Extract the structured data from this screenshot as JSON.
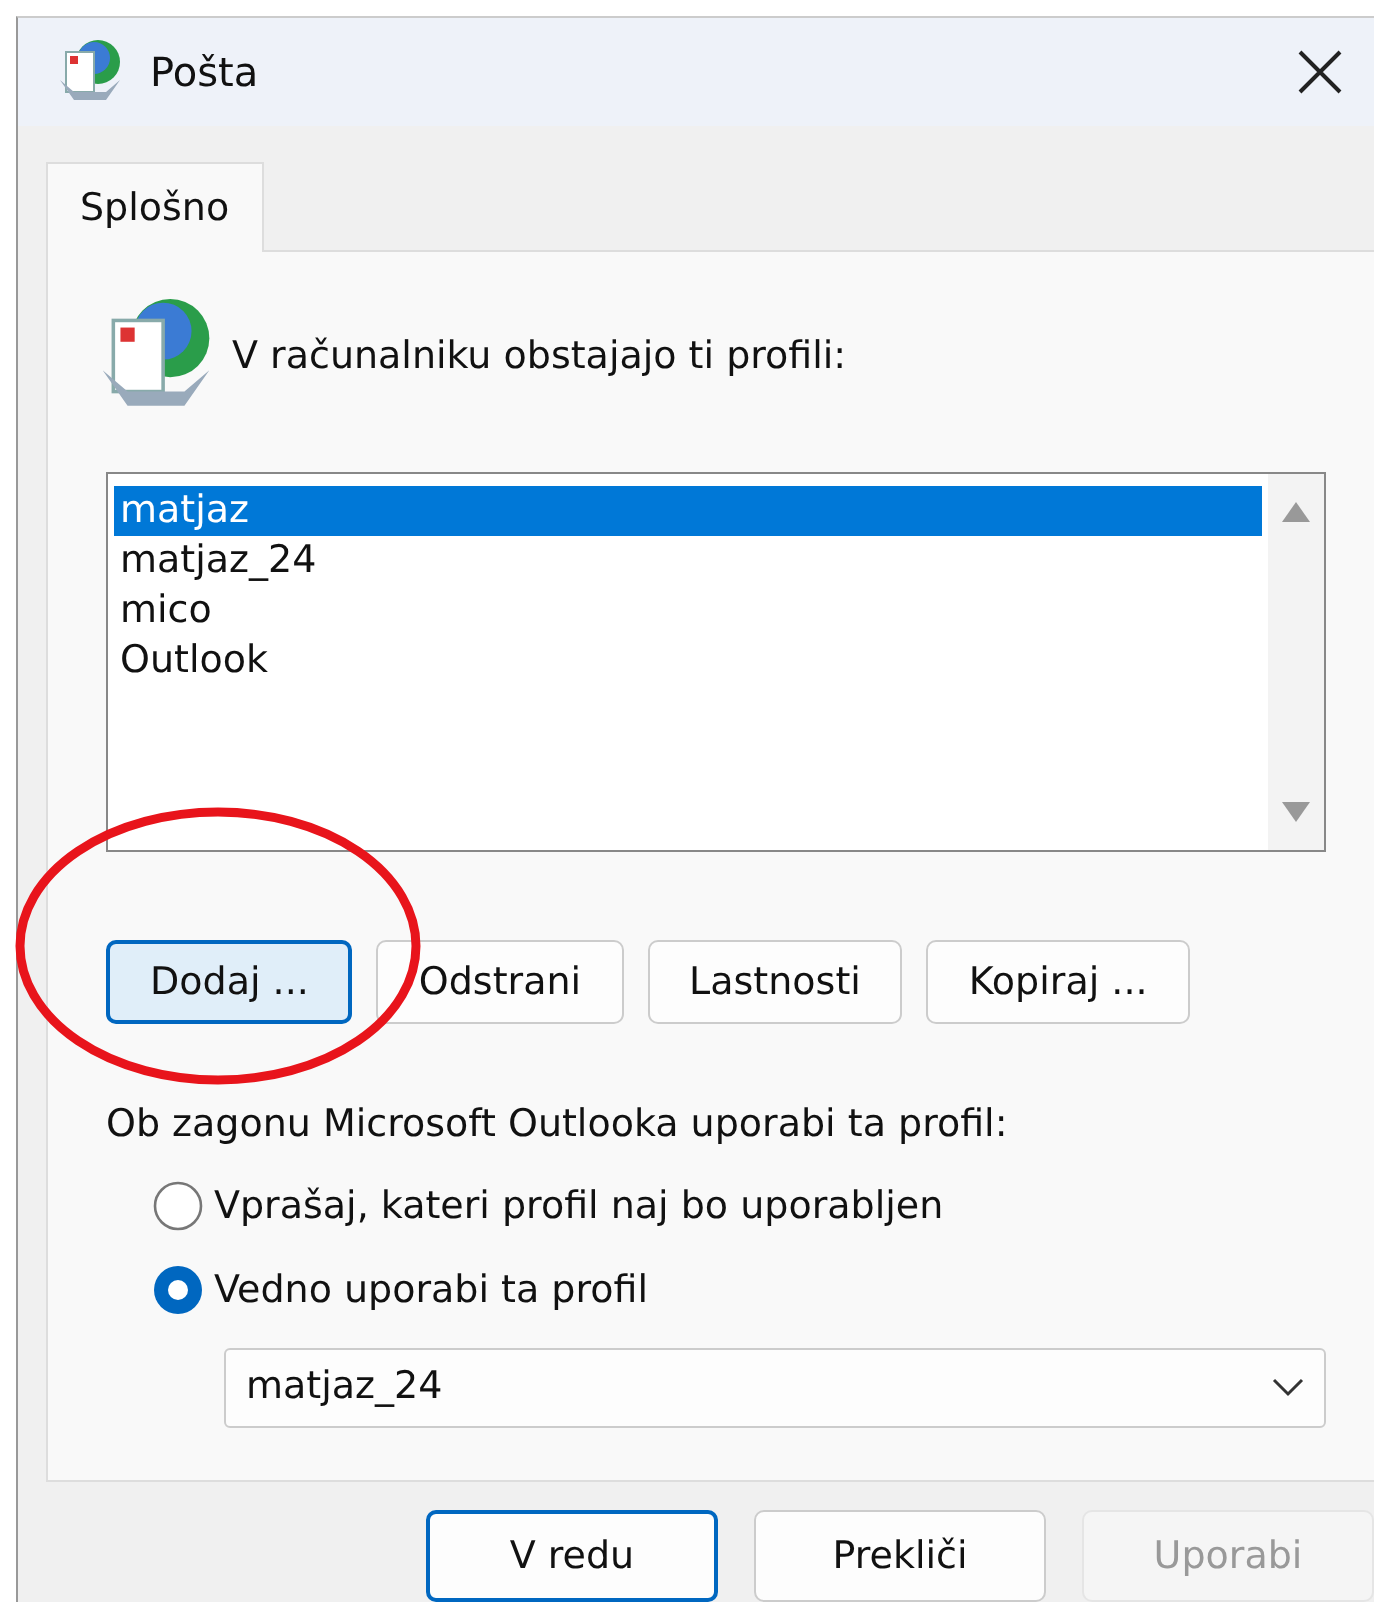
{
  "window": {
    "title": "Pošta"
  },
  "tabs": [
    {
      "label": "Splošno",
      "selected": true
    }
  ],
  "intro": "V računalniku obstajajo ti profili:",
  "profiles": [
    {
      "name": "matjaz",
      "selected": true
    },
    {
      "name": "matjaz_24",
      "selected": false
    },
    {
      "name": "mico",
      "selected": false
    },
    {
      "name": "Outlook",
      "selected": false
    }
  ],
  "profile_buttons": [
    {
      "label": "Dodaj ...",
      "focused": true
    },
    {
      "label": "Odstrani",
      "focused": false
    },
    {
      "label": "Lastnosti",
      "focused": false
    },
    {
      "label": "Kopiraj ...",
      "focused": false
    }
  ],
  "startup_label": "Ob zagonu Microsoft Outlooka uporabi ta profil:",
  "startup_options": [
    {
      "label": "Vprašaj, kateri profil naj bo uporabljen",
      "selected": false
    },
    {
      "label": "Vedno uporabi ta profil",
      "selected": true
    }
  ],
  "profile_select": {
    "value": "matjaz_24"
  },
  "dialog_buttons": [
    {
      "label": "V redu",
      "default": true,
      "disabled": false
    },
    {
      "label": "Prekliči",
      "default": false,
      "disabled": false
    },
    {
      "label": "Uporabi",
      "default": false,
      "disabled": true
    }
  ],
  "annotation": {
    "kind": "circle"
  }
}
